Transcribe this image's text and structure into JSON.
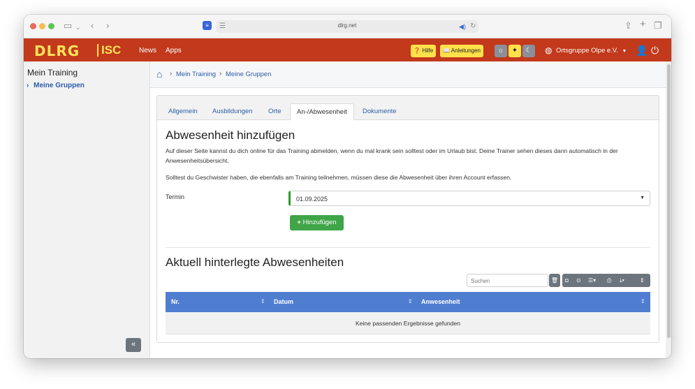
{
  "browser": {
    "url": "dlrg.net"
  },
  "navbar": {
    "logo_main": "DLRG",
    "logo_sub": "ISC",
    "links": [
      "News",
      "Apps"
    ],
    "help_label": "Hilfe",
    "guides_label": "Anleitungen",
    "org_label": "Ortsgruppe Olpe e.V.",
    "accent_color": "#c2391c",
    "logo_color": "#ffe35a"
  },
  "sidebar": {
    "title": "Mein Training",
    "items": [
      {
        "label": "Meine Gruppen",
        "icon": "chevron-right-icon"
      }
    ],
    "collapse_label": "«"
  },
  "breadcrumb": {
    "items": [
      "Mein Training",
      "Meine Gruppen"
    ],
    "separator": "›"
  },
  "tabs": [
    {
      "label": "Allgemein",
      "active": false
    },
    {
      "label": "Ausbildungen",
      "active": false
    },
    {
      "label": "Orte",
      "active": false
    },
    {
      "label": "An-/Abwesenheit",
      "active": true
    },
    {
      "label": "Dokumente",
      "active": false
    }
  ],
  "absence_form": {
    "heading": "Abwesenheit hinzufügen",
    "intro": "Auf dieser Seite kannst du dich online für das Training abmelden, wenn du mal krank sein solltest oder im Urlaub bist. Deine Trainer sehen dieses dann automatisch in der Anwesenheitsübersicht.",
    "siblings_note": "Solltest du Geschwister haben, die ebenfalls am Training teilnehmen, müssen diese die Abwesenheit über ihren Account erfassen.",
    "termin_label": "Termin",
    "termin_value": "01.09.2025",
    "add_button": "Hinzufügen"
  },
  "absences": {
    "heading": "Aktuell hinterlegte Abwesenheiten",
    "search_placeholder": "Suchen",
    "columns": [
      "Nr.",
      "Datum",
      "Anwesenheit"
    ],
    "rows": [],
    "empty_text": "Keine passenden Ergebnisse gefunden",
    "header_color": "#4f7ed1"
  }
}
